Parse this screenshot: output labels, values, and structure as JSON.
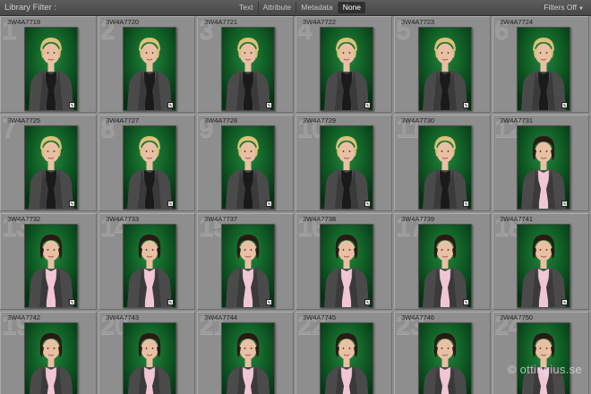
{
  "filter_bar": {
    "title": "Library Filter :",
    "tabs": [
      {
        "label": "Text",
        "active": false
      },
      {
        "label": "Attribute",
        "active": false
      },
      {
        "label": "Metadata",
        "active": false
      },
      {
        "label": "None",
        "active": true
      }
    ],
    "preset_label": "Filters Off"
  },
  "grid": {
    "cells": [
      {
        "number": "1",
        "filename": "3W4A7719",
        "subject": "blonde"
      },
      {
        "number": "2",
        "filename": "3W4A7720",
        "subject": "blonde"
      },
      {
        "number": "3",
        "filename": "3W4A7721",
        "subject": "blonde"
      },
      {
        "number": "4",
        "filename": "3W4A7722",
        "subject": "blonde"
      },
      {
        "number": "5",
        "filename": "3W4A7723",
        "subject": "blonde"
      },
      {
        "number": "6",
        "filename": "3W4A7724",
        "subject": "blonde"
      },
      {
        "number": "7",
        "filename": "3W4A7725",
        "subject": "blonde"
      },
      {
        "number": "8",
        "filename": "3W4A7727",
        "subject": "blonde"
      },
      {
        "number": "9",
        "filename": "3W4A7728",
        "subject": "blonde"
      },
      {
        "number": "10",
        "filename": "3W4A7729",
        "subject": "blonde"
      },
      {
        "number": "11",
        "filename": "3W4A7730",
        "subject": "blonde"
      },
      {
        "number": "12",
        "filename": "3W4A7731",
        "subject": "brunette"
      },
      {
        "number": "13",
        "filename": "3W4A7732",
        "subject": "brunette"
      },
      {
        "number": "14",
        "filename": "3W4A7733",
        "subject": "brunette"
      },
      {
        "number": "15",
        "filename": "3W4A7737",
        "subject": "brunette"
      },
      {
        "number": "16",
        "filename": "3W4A7738",
        "subject": "brunette"
      },
      {
        "number": "17",
        "filename": "3W4A7739",
        "subject": "brunette"
      },
      {
        "number": "18",
        "filename": "3W4A7741",
        "subject": "brunette"
      },
      {
        "number": "19",
        "filename": "3W4A7742",
        "subject": "brunette"
      },
      {
        "number": "20",
        "filename": "3W4A7743",
        "subject": "brunette"
      },
      {
        "number": "21",
        "filename": "3W4A7744",
        "subject": "brunette"
      },
      {
        "number": "22",
        "filename": "3W4A7745",
        "subject": "brunette"
      },
      {
        "number": "23",
        "filename": "3W4A7746",
        "subject": "brunette"
      },
      {
        "number": "24",
        "filename": "3W4A7750",
        "subject": "brunette"
      }
    ]
  },
  "watermark": "© ottingius.se",
  "colors": {
    "backdrop": "#0f5a24",
    "jacket": "#4a4a4a",
    "blonde_hair": "#d9c27a",
    "brunette_hair": "#2a1a14",
    "skin": "#e9c0a4",
    "blonde_top": "#1a1a1a",
    "brunette_top": "#f0c6d6"
  }
}
